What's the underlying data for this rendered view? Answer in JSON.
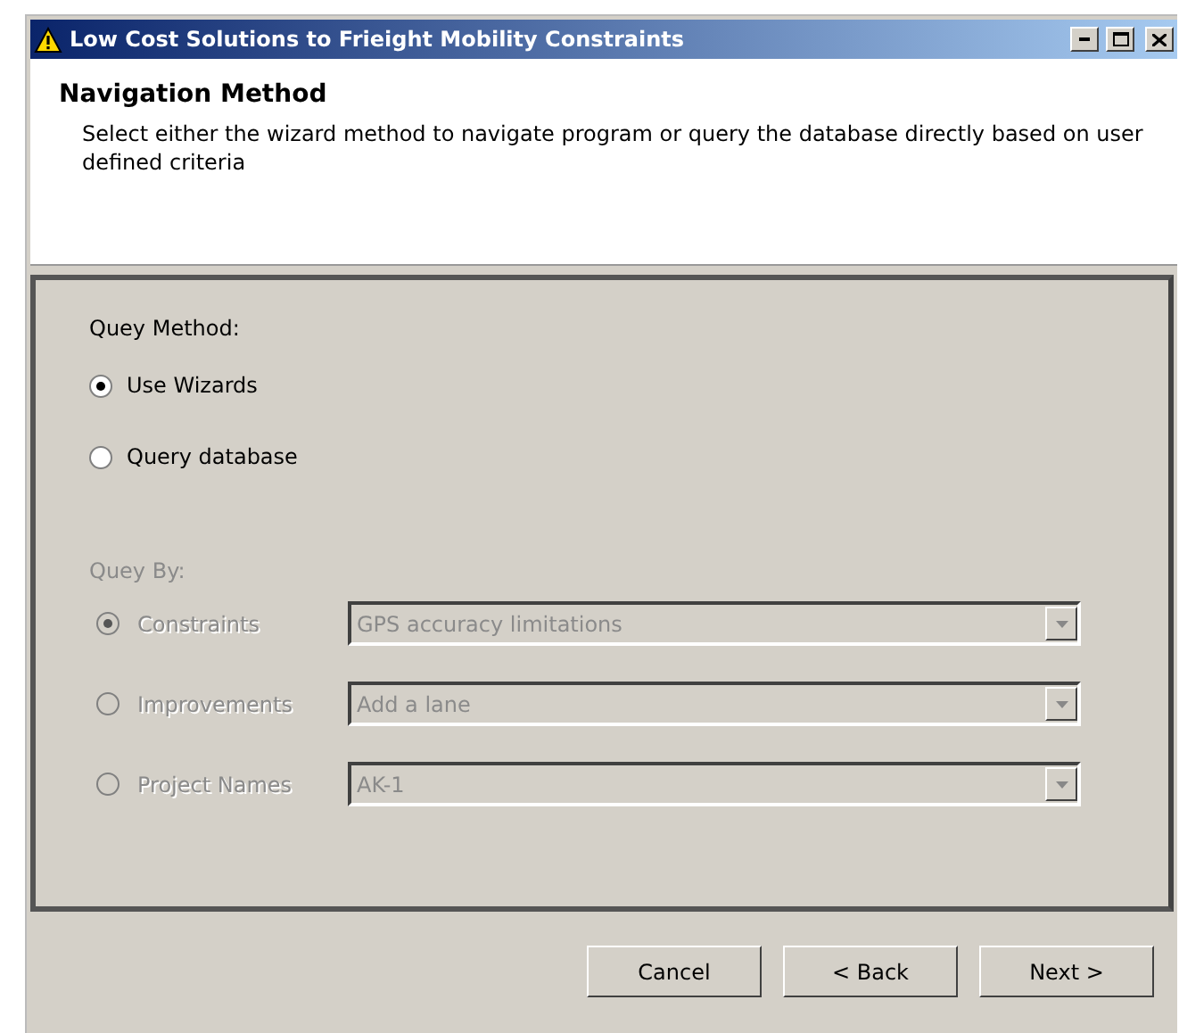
{
  "window": {
    "title": "Low Cost Solutions to Frieight Mobility Constraints"
  },
  "header": {
    "title": "Navigation Method",
    "description": "Select either the wizard method to navigate program or query the database directly based on user defined criteria"
  },
  "query_method": {
    "label": "Quey Method:",
    "options": [
      {
        "label": "Use Wizards",
        "selected": true
      },
      {
        "label": "Query database",
        "selected": false
      }
    ]
  },
  "query_by": {
    "label": "Quey By:",
    "disabled": true,
    "rows": [
      {
        "label": "Constraints",
        "selected": true,
        "value": "GPS accuracy limitations"
      },
      {
        "label": "Improvements",
        "selected": false,
        "value": "Add a lane"
      },
      {
        "label": "Project Names",
        "selected": false,
        "value": "AK-1"
      }
    ]
  },
  "buttons": [
    "Cancel",
    "< Back",
    "Next >"
  ]
}
